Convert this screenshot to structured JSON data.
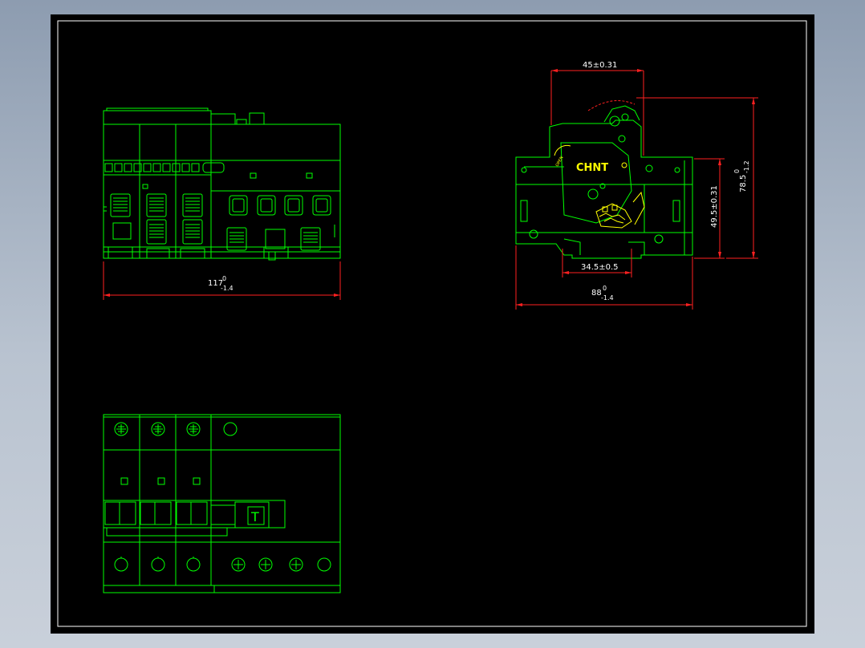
{
  "colors": {
    "outline": "#00ff00",
    "dimension": "#ff2020",
    "text": "#ffffff",
    "highlight": "#ffff00",
    "canvas": "#000000"
  },
  "dimensions": {
    "front_width": {
      "value": "117",
      "upper": "0",
      "lower": "-1.4"
    },
    "side_top_width": {
      "value": "45±0.31"
    },
    "side_base_width": {
      "value": "34.5±0.5"
    },
    "side_total_width": {
      "value": "88",
      "upper": "0",
      "lower": "-1.4"
    },
    "side_inner_height": {
      "value": "49.5±0.31"
    },
    "side_total_height": {
      "value": "78.5",
      "upper": "0",
      "lower": "-1.2"
    }
  },
  "labels": {
    "brand": "CHNT",
    "open_mark": "OPEN",
    "test_button": "T"
  }
}
